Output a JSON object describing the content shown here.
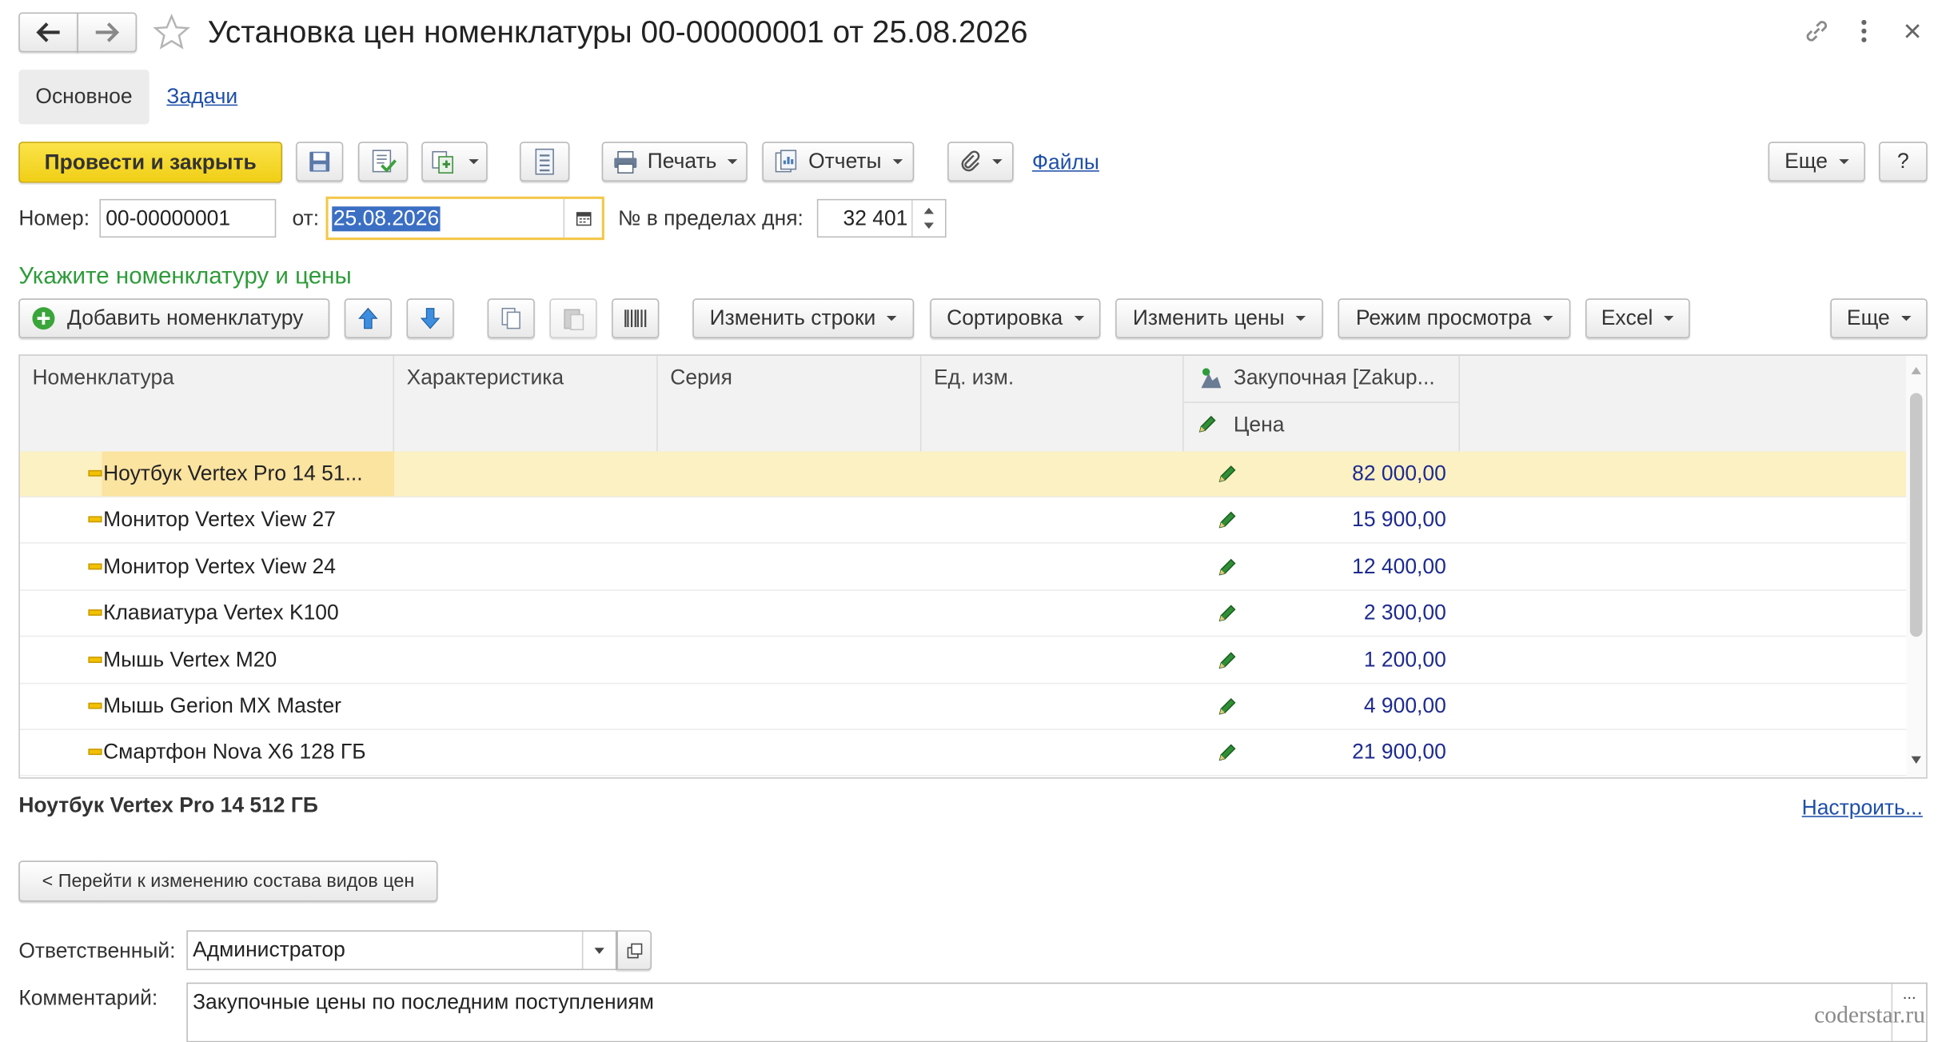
{
  "window": {
    "title": "Установка цен номенклатуры 00-00000001 от 25.08.2026"
  },
  "tabs": [
    {
      "label": "Основное",
      "active": true
    },
    {
      "label": "Задачи",
      "active": false
    }
  ],
  "toolbar": {
    "post_close": "Провести и закрыть",
    "print": "Печать",
    "reports": "Отчеты",
    "files": "Файлы",
    "more": "Еще",
    "help": "?"
  },
  "header_fields": {
    "number_label": "Номер:",
    "number_value": "00-00000001",
    "date_label": "от:",
    "date_value": "25.08.2026",
    "daynum_label": "№ в пределах дня:",
    "daynum_value": "32 401"
  },
  "section_title": "Укажите номенклатуру и цены",
  "table_toolbar": {
    "add_item": "Добавить номенклатуру",
    "change_rows": "Изменить строки",
    "sort": "Сортировка",
    "change_prices": "Изменить цены",
    "view_mode": "Режим просмотра",
    "excel": "Excel",
    "more": "Еще"
  },
  "table": {
    "columns": [
      "Номенклатура",
      "Характеристика",
      "Серия",
      "Ед. изм.",
      "Закупочная [Zakup..."
    ],
    "price_subheader": "Цена",
    "rows": [
      {
        "name": "Ноутбук Vertex Pro 14 51...",
        "price": "82 000,00",
        "selected": true
      },
      {
        "name": "Монитор Vertex View 27",
        "price": "15 900,00"
      },
      {
        "name": "Монитор Vertex View 24",
        "price": "12 400,00"
      },
      {
        "name": "Клавиатура Vertex K100",
        "price": "2 300,00"
      },
      {
        "name": "Мышь Vertex M20",
        "price": "1 200,00"
      },
      {
        "name": "Мышь Gerion MX Master",
        "price": "4 900,00"
      },
      {
        "name": "Смартфон Nova X6 128 ГБ",
        "price": "21 900,00"
      }
    ]
  },
  "selected_item_title": "Ноутбук Vertex Pro 14 512 ГБ",
  "customize_link": "Настроить...",
  "go_to_price_types": "< Перейти к изменению состава видов цен",
  "footer": {
    "responsible_label": "Ответственный:",
    "responsible_value": "Администратор",
    "comment_label": "Комментарий:",
    "comment_value": "Закупочные цены по последним поступлениям"
  },
  "watermark": "coderstar.ru",
  "colors": {
    "primary_button": "#f7d92e",
    "section_title": "#2e9b3a",
    "link": "#1f4fa8",
    "selected_row": "#fcf1c3",
    "price_text": "#1d2a8f"
  }
}
